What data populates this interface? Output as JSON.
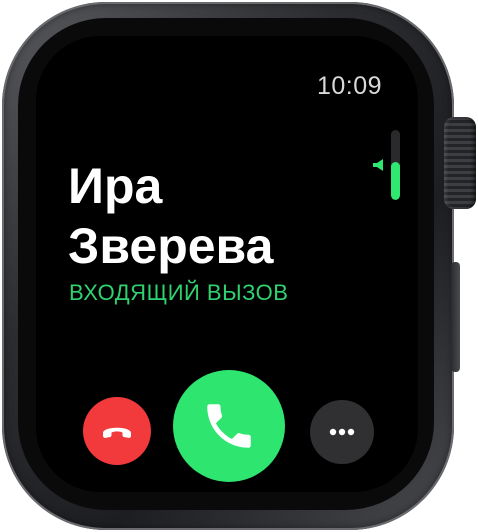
{
  "status_bar": {
    "time": "10:09"
  },
  "call": {
    "caller_name": "Ира Зверева",
    "status": "ВХОДЯЩИЙ ВЫЗОВ"
  },
  "volume": {
    "level": 0.55,
    "icon": "speaker-icon"
  },
  "actions": {
    "decline_icon": "phone-hangup-icon",
    "accept_icon": "phone-icon",
    "more_icon": "ellipsis-icon"
  },
  "colors": {
    "accept": "#2ee570",
    "decline": "#f2393c",
    "status_text": "#2fd26f",
    "more_button": "#303033"
  }
}
